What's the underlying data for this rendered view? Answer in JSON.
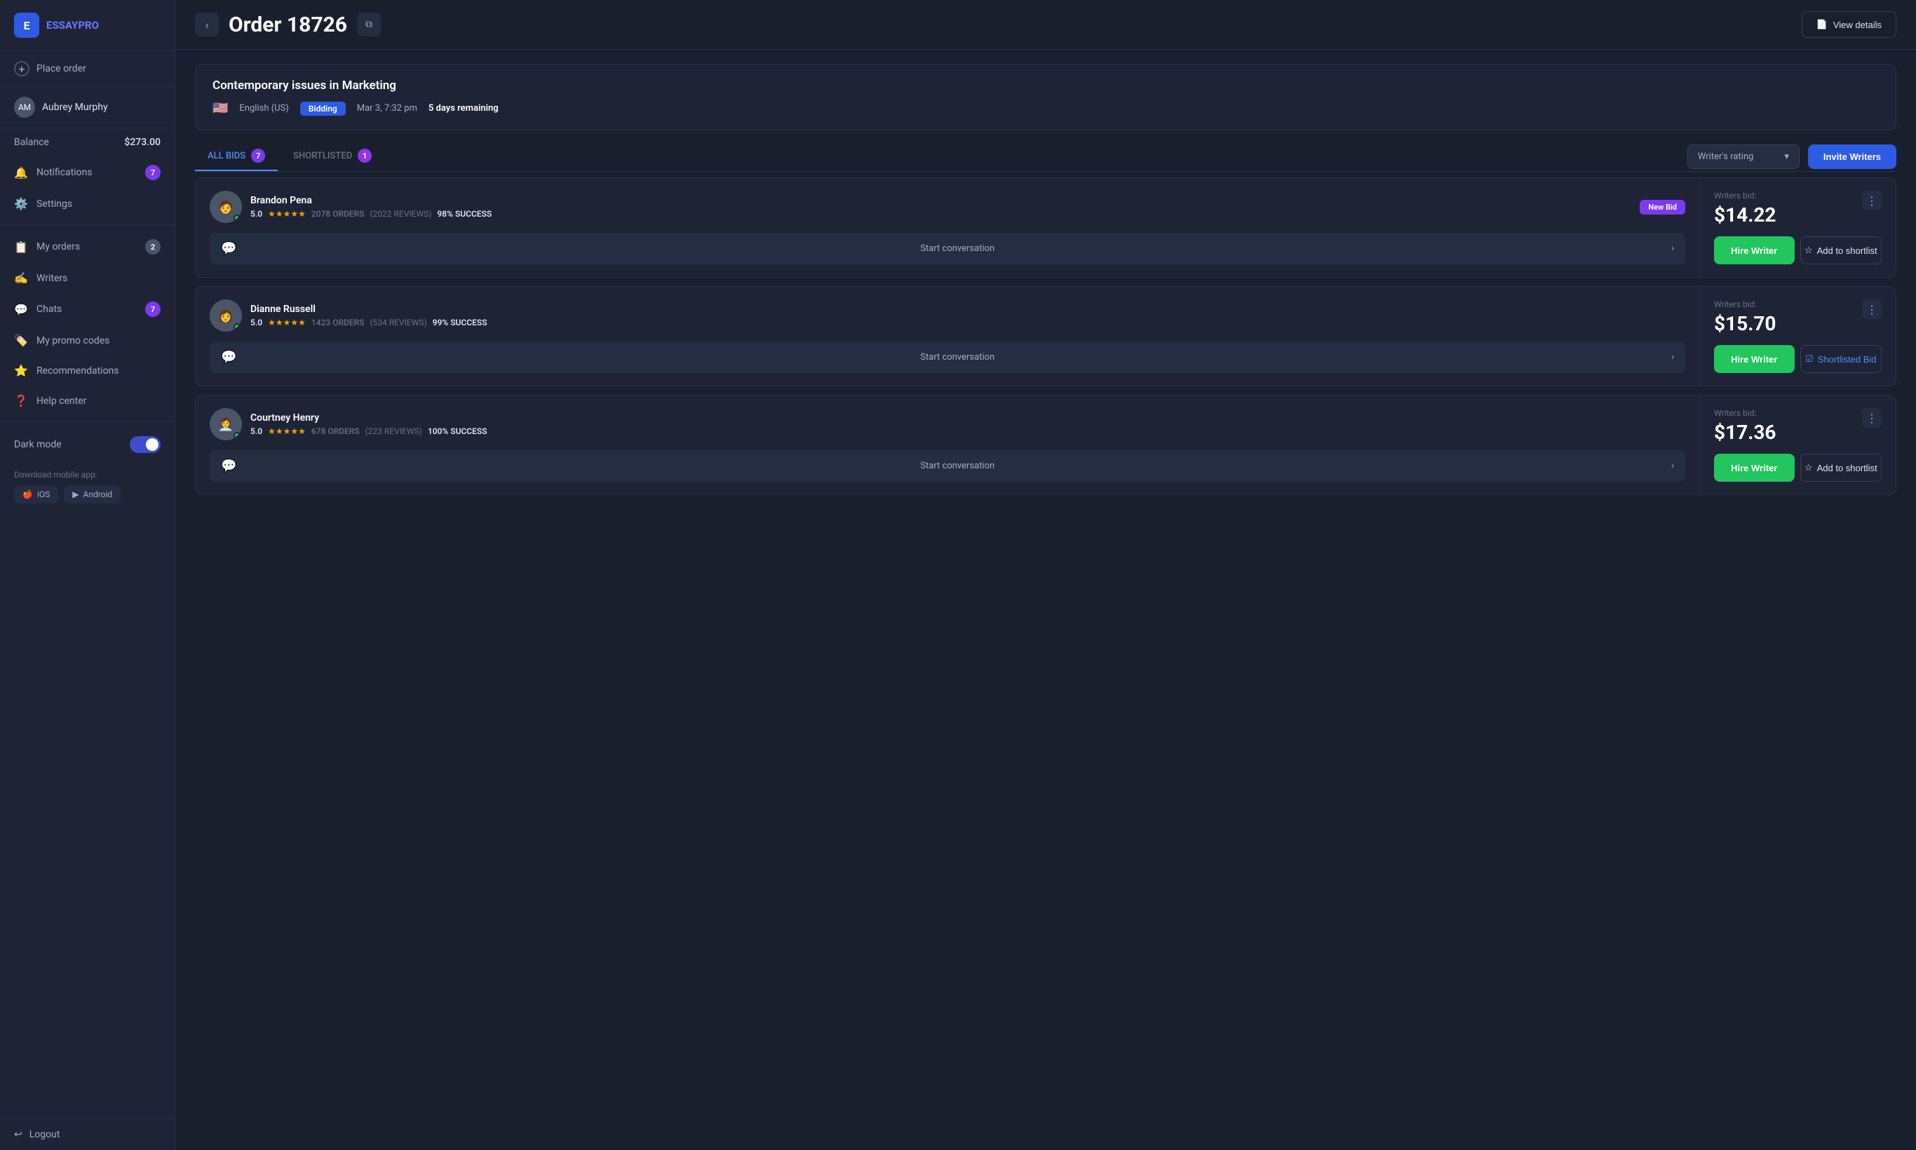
{
  "app": {
    "name": "ESSAY",
    "name_accent": "PRO"
  },
  "sidebar": {
    "place_order_label": "Place order",
    "user": {
      "name": "Aubrey Murphy",
      "initials": "AM"
    },
    "balance_label": "Balance",
    "balance_value": "$273.00",
    "nav_items": [
      {
        "id": "my-orders",
        "label": "My orders",
        "badge": "2",
        "icon": "📋"
      },
      {
        "id": "writers",
        "label": "Writers",
        "badge": "",
        "icon": "✍️"
      },
      {
        "id": "chats",
        "label": "Chats",
        "badge": "7",
        "icon": "💬"
      },
      {
        "id": "my-promo-codes",
        "label": "My promo codes",
        "badge": "",
        "icon": "🏷️"
      },
      {
        "id": "recommendations",
        "label": "Recommendations",
        "badge": "",
        "icon": "⭐"
      },
      {
        "id": "help-center",
        "label": "Help center",
        "badge": "",
        "icon": "❓"
      }
    ],
    "notifications_label": "Notifications",
    "notifications_badge": "7",
    "settings_label": "Settings",
    "dark_mode_label": "Dark mode",
    "download_label": "Download mobile app:",
    "ios_label": "iOS",
    "android_label": "Android",
    "logout_label": "Logout"
  },
  "header": {
    "back_label": "‹",
    "order_title": "Order 18726",
    "copy_icon": "⧉",
    "view_details_label": "View details"
  },
  "order_info": {
    "title": "Contemporary issues in Marketing",
    "flag": "🇺🇸",
    "language": "English (US)",
    "status": "Bidding",
    "date": "Mar 3, 7:32 pm",
    "remaining": "5 days remaining"
  },
  "tabs": {
    "all_bids_label": "ALL BIDS",
    "all_bids_count": "7",
    "shortlisted_label": "SHORTLISTED",
    "shortlisted_count": "1",
    "sort_placeholder": "Writer's rating",
    "invite_label": "Invite Writers"
  },
  "bids": [
    {
      "id": 1,
      "writer_name": "Brandon Pena",
      "rating": "5.0",
      "stars": "★★★★★",
      "orders": "2078",
      "reviews": "2022",
      "success": "98",
      "is_new": true,
      "new_badge_label": "New Bid",
      "price": "$14.22",
      "hire_label": "Hire Writer",
      "shortlist_label": "Add to shortlist",
      "shortlisted": false,
      "conversation_label": "Start conversation",
      "emoji": "🧑"
    },
    {
      "id": 2,
      "writer_name": "Dianne Russell",
      "rating": "5.0",
      "stars": "★★★★★",
      "orders": "1423",
      "reviews": "534",
      "success": "99",
      "is_new": false,
      "new_badge_label": "",
      "price": "$15.70",
      "hire_label": "Hire Writer",
      "shortlist_label": "Shortlisted Bid",
      "shortlisted": true,
      "conversation_label": "Start conversation",
      "emoji": "👩"
    },
    {
      "id": 3,
      "writer_name": "Courtney Henry",
      "rating": "5.0",
      "stars": "★★★★★",
      "orders": "678",
      "reviews": "223",
      "success": "100",
      "is_new": false,
      "new_badge_label": "",
      "price": "$17.36",
      "hire_label": "Hire Writer",
      "shortlist_label": "Add to shortlist",
      "shortlisted": false,
      "conversation_label": "Start conversation",
      "emoji": "👩‍💼"
    }
  ],
  "writers_bid_label": "Writers bid:"
}
